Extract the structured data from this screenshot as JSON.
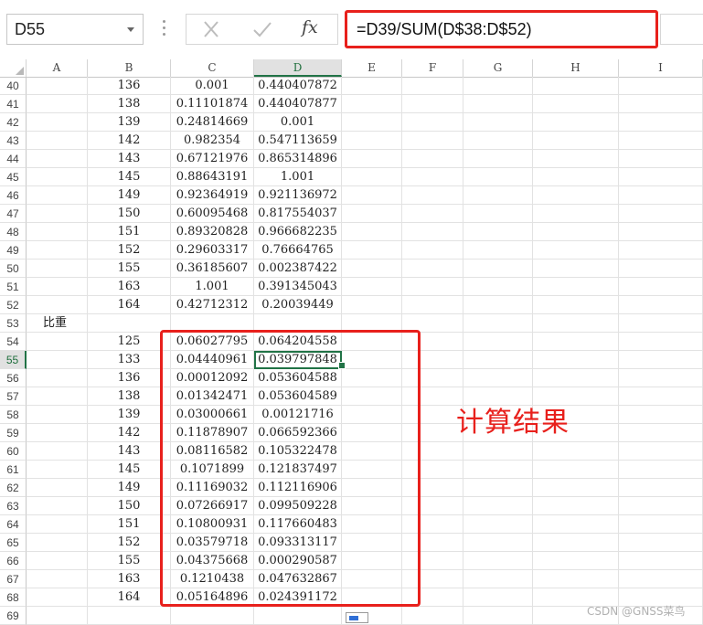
{
  "name_box": "D55",
  "formula": "=D39/SUM(D$38:D$52)",
  "fx_label": "fx",
  "columns": [
    "A",
    "B",
    "C",
    "D",
    "E",
    "F",
    "G",
    "H",
    "I"
  ],
  "selected_column": "D",
  "selected_row": "55",
  "rows": [
    {
      "n": "40",
      "a": "",
      "b": "136",
      "c": "0.001",
      "d": "0.440407872"
    },
    {
      "n": "41",
      "a": "",
      "b": "138",
      "c": "0.11101874",
      "d": "0.440407877"
    },
    {
      "n": "42",
      "a": "",
      "b": "139",
      "c": "0.24814669",
      "d": "0.001"
    },
    {
      "n": "43",
      "a": "",
      "b": "142",
      "c": "0.982354",
      "d": "0.547113659"
    },
    {
      "n": "44",
      "a": "",
      "b": "143",
      "c": "0.67121976",
      "d": "0.865314896"
    },
    {
      "n": "45",
      "a": "",
      "b": "145",
      "c": "0.88643191",
      "d": "1.001"
    },
    {
      "n": "46",
      "a": "",
      "b": "149",
      "c": "0.92364919",
      "d": "0.921136972"
    },
    {
      "n": "47",
      "a": "",
      "b": "150",
      "c": "0.60095468",
      "d": "0.817554037"
    },
    {
      "n": "48",
      "a": "",
      "b": "151",
      "c": "0.89320828",
      "d": "0.966682235"
    },
    {
      "n": "49",
      "a": "",
      "b": "152",
      "c": "0.29603317",
      "d": "0.76664765"
    },
    {
      "n": "50",
      "a": "",
      "b": "155",
      "c": "0.36185607",
      "d": "0.002387422"
    },
    {
      "n": "51",
      "a": "",
      "b": "163",
      "c": "1.001",
      "d": "0.391345043"
    },
    {
      "n": "52",
      "a": "",
      "b": "164",
      "c": "0.42712312",
      "d": "0.20039449"
    },
    {
      "n": "53",
      "a": "比重",
      "b": "",
      "c": "",
      "d": ""
    },
    {
      "n": "54",
      "a": "",
      "b": "125",
      "c": "0.06027795",
      "d": "0.064204558"
    },
    {
      "n": "55",
      "a": "",
      "b": "133",
      "c": "0.04440961",
      "d": "0.039797848"
    },
    {
      "n": "56",
      "a": "",
      "b": "136",
      "c": "0.00012092",
      "d": "0.053604588"
    },
    {
      "n": "57",
      "a": "",
      "b": "138",
      "c": "0.01342471",
      "d": "0.053604589"
    },
    {
      "n": "58",
      "a": "",
      "b": "139",
      "c": "0.03000661",
      "d": "0.00121716"
    },
    {
      "n": "59",
      "a": "",
      "b": "142",
      "c": "0.11878907",
      "d": "0.066592366"
    },
    {
      "n": "60",
      "a": "",
      "b": "143",
      "c": "0.08116582",
      "d": "0.105322478"
    },
    {
      "n": "61",
      "a": "",
      "b": "145",
      "c": "0.1071899",
      "d": "0.121837497"
    },
    {
      "n": "62",
      "a": "",
      "b": "149",
      "c": "0.11169032",
      "d": "0.112116906"
    },
    {
      "n": "63",
      "a": "",
      "b": "150",
      "c": "0.07266917",
      "d": "0.099509228"
    },
    {
      "n": "64",
      "a": "",
      "b": "151",
      "c": "0.10800931",
      "d": "0.117660483"
    },
    {
      "n": "65",
      "a": "",
      "b": "152",
      "c": "0.03579718",
      "d": "0.093313117"
    },
    {
      "n": "66",
      "a": "",
      "b": "155",
      "c": "0.04375668",
      "d": "0.000290587"
    },
    {
      "n": "67",
      "a": "",
      "b": "163",
      "c": "0.1210438",
      "d": "0.047632867"
    },
    {
      "n": "68",
      "a": "",
      "b": "164",
      "c": "0.05164896",
      "d": "0.024391172"
    },
    {
      "n": "69",
      "a": "",
      "b": "",
      "c": "",
      "d": ""
    }
  ],
  "annotation": "计算结果",
  "watermark": "CSDN @GNSS菜鸟",
  "colors": {
    "highlight_red": "#e8201c",
    "excel_green": "#217346"
  }
}
